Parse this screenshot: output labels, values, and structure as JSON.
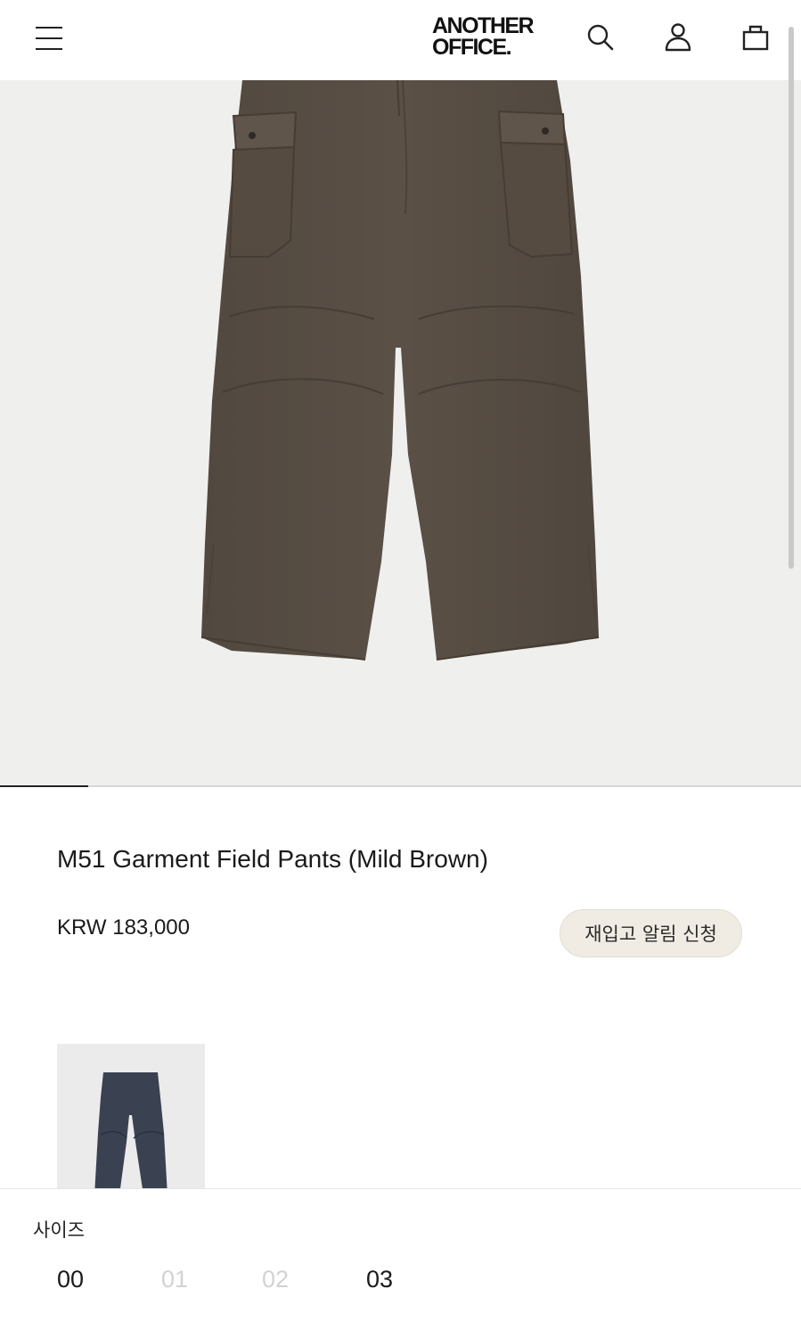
{
  "header": {
    "brand_line1": "ANOTHER",
    "brand_line2": "OFFICE.",
    "icons": [
      "menu-icon",
      "search-icon",
      "user-icon",
      "shopping-bag-icon"
    ]
  },
  "gallery": {
    "product_color": "#5a5046",
    "background_color": "#efefee",
    "progress": 0.11
  },
  "product": {
    "name": "M51 Garment Field Pants (Mild Brown)",
    "price": "KRW 183,000",
    "restock_button": "재입고 알림 신청"
  },
  "color_swatches": [
    {
      "color": "#3a4252"
    }
  ],
  "size_selector": {
    "label": "사이즈",
    "options": [
      {
        "label": "00",
        "available": true
      },
      {
        "label": "01",
        "available": false
      },
      {
        "label": "02",
        "available": false
      },
      {
        "label": "03",
        "available": true
      }
    ]
  }
}
